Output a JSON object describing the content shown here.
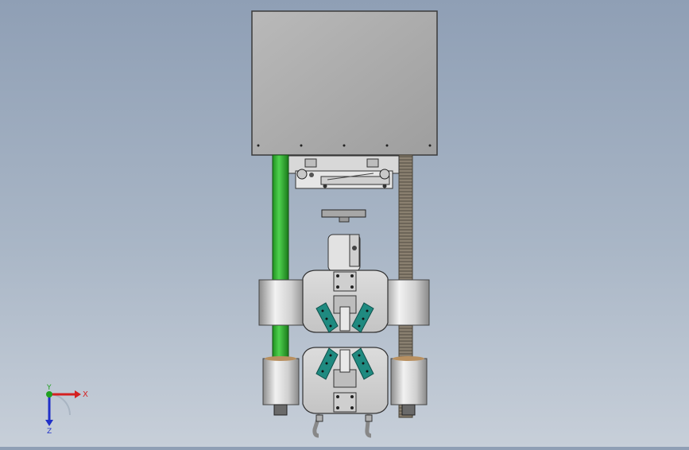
{
  "viewport": {
    "background_top": "#8f9fb5",
    "background_bottom": "#c7cfd9",
    "accent_green": "#2eb82e",
    "clamp_teal": "#1f8a80"
  },
  "triad": {
    "x_label": "X",
    "y_label": "Y",
    "z_label": "Z",
    "x_color": "#d42020",
    "y_color": "#20a020",
    "z_color": "#2030c8"
  }
}
